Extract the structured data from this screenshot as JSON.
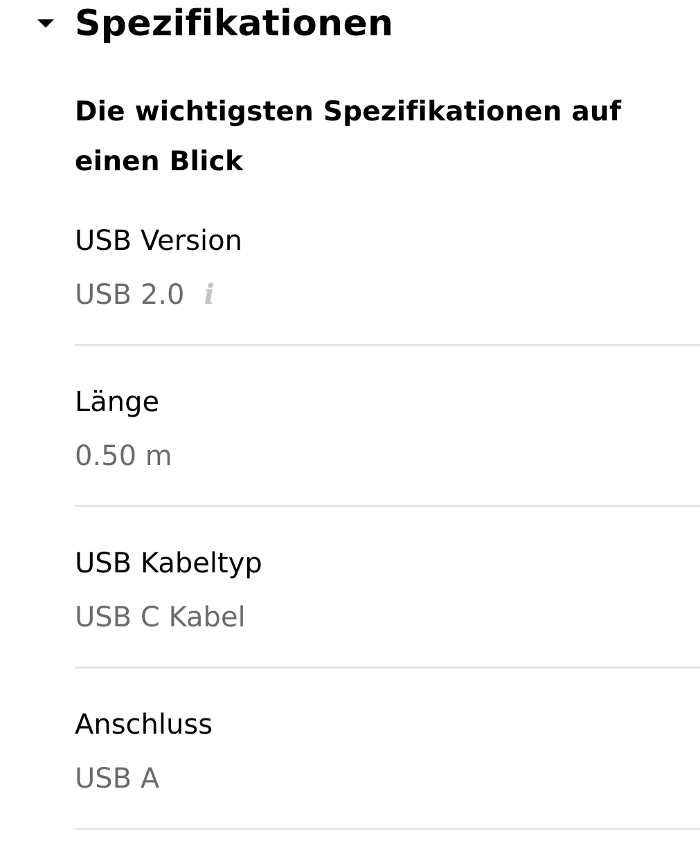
{
  "section": {
    "title": "Spezifikationen",
    "expanded": true,
    "toggle_icon": "caret-down-icon",
    "subtitle": "Die wichtigsten Spezifikationen auf einen Blick"
  },
  "specs": [
    {
      "label": "USB Version",
      "value": "USB 2.0",
      "has_info": true,
      "info_glyph": "i"
    },
    {
      "label": "Länge",
      "value": "0.50 m"
    },
    {
      "label": "USB Kabeltyp",
      "value": "USB C Kabel"
    },
    {
      "label": "Anschluss",
      "value": "USB A"
    }
  ],
  "colors": {
    "text": "#000000",
    "value_text": "#6b6b6b",
    "info_icon": "#c4c4c4",
    "divider": "#e6e6e6",
    "background": "#ffffff"
  }
}
